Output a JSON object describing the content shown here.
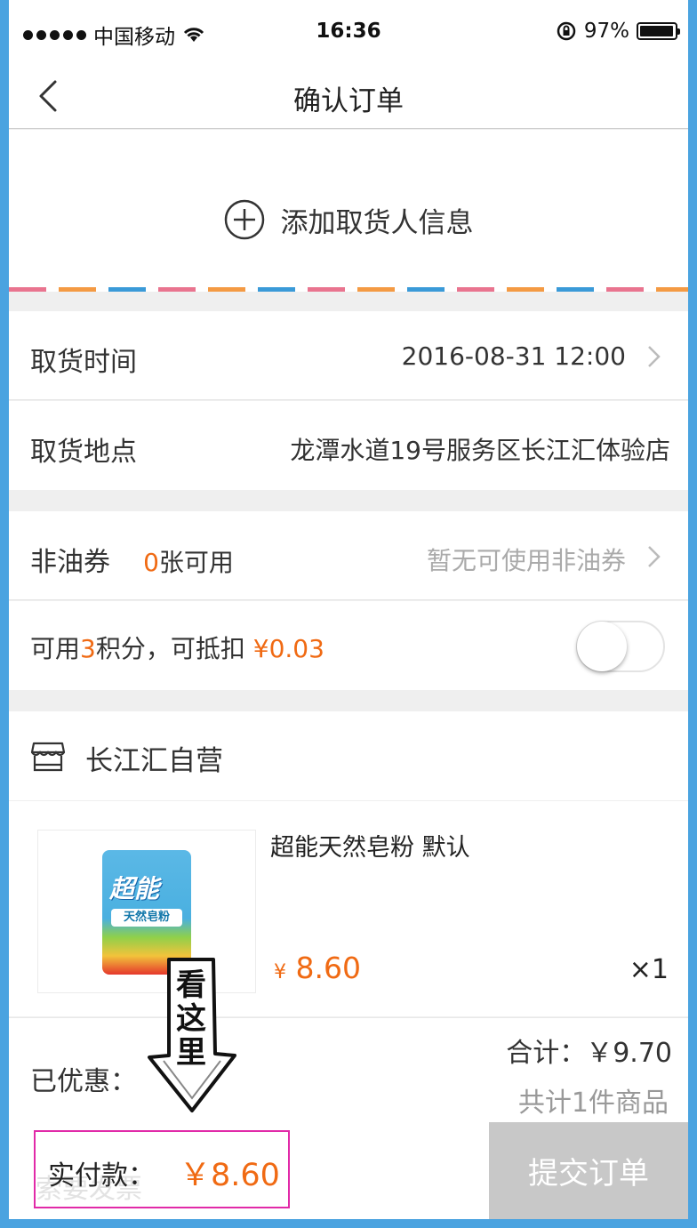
{
  "status_bar": {
    "carrier": "中国移动",
    "time": "16:36",
    "battery": "97%"
  },
  "nav": {
    "title": "确认订单"
  },
  "address": {
    "add_label": "添加取货人信息"
  },
  "pickup": {
    "time_label": "取货时间",
    "time_value": "2016-08-31 12:00",
    "location_label": "取货地点",
    "location_value": "龙潭水道19号服务区长江汇体验店"
  },
  "coupon": {
    "label": "非油券",
    "count": "0",
    "count_suffix": "张可用",
    "status": "暂无可使用非油券"
  },
  "points": {
    "prefix": "可用",
    "count": "3",
    "middle": "积分，可抵扣",
    "amount": "¥0.03",
    "toggle_on": false
  },
  "store": {
    "name": "长江汇自营"
  },
  "product": {
    "name": "超能天然皂粉 默认",
    "price_symbol": "¥",
    "price": "8.60",
    "quantity": "×1",
    "image_brand": "超能",
    "image_sub": "天然皂粉"
  },
  "summary": {
    "saved_label": "已优惠：",
    "total": "合计：￥9.70",
    "count": "共计1件商品"
  },
  "footer": {
    "invoice_ghost": "索要发票",
    "pay_label": "实付款：",
    "pay_amount": "￥8.60",
    "submit_label": "提交订单"
  },
  "annotation": {
    "text_line1": "看",
    "text_line2": "这",
    "text_line3": "里"
  },
  "colors": {
    "accent": "#f06a13",
    "highlight_box": "#e12aa8",
    "frame": "#4aa3e0"
  }
}
